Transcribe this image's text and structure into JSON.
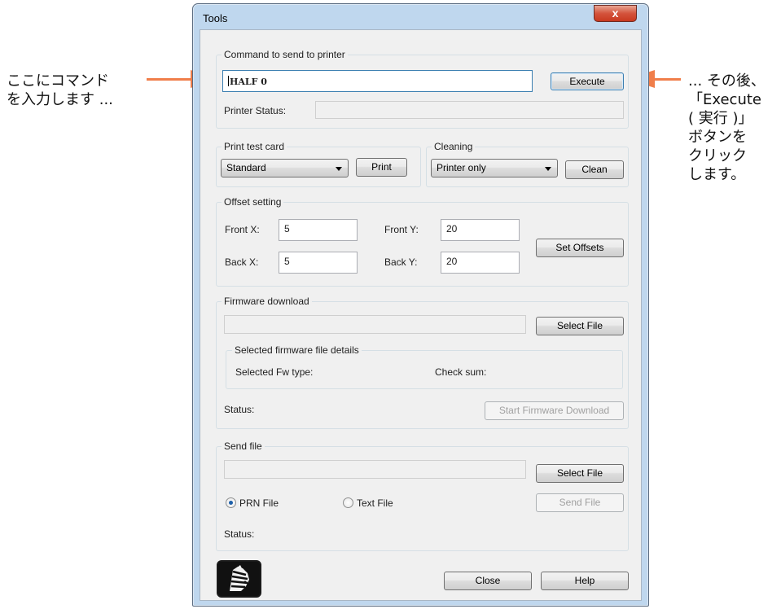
{
  "callouts": {
    "left": [
      "ここにコマンド",
      "を入力します ..."
    ],
    "right": [
      "... その後、",
      "「Execute",
      "( 実行 )」",
      "ボタンを",
      "クリック",
      "します。"
    ]
  },
  "colors": {
    "arrow": "#f07e4a",
    "title_close": "#c8391f"
  },
  "window": {
    "title": "Tools",
    "close_glyph": "x"
  },
  "command": {
    "group_label": "Command to send to printer",
    "value": "HALF 0",
    "execute_label": "Execute",
    "status_label": "Printer Status:",
    "status_value": ""
  },
  "print_test": {
    "group_label": "Print test card",
    "selected": "Standard",
    "print_label": "Print"
  },
  "cleaning": {
    "group_label": "Cleaning",
    "selected": "Printer only",
    "clean_label": "Clean"
  },
  "offset": {
    "group_label": "Offset setting",
    "front_x_label": "Front X:",
    "front_x": "5",
    "front_y_label": "Front Y:",
    "front_y": "20",
    "back_x_label": "Back X:",
    "back_x": "5",
    "back_y_label": "Back Y:",
    "back_y": "20",
    "set_label": "Set Offsets"
  },
  "firmware": {
    "group_label": "Firmware download",
    "file_value": "",
    "select_label": "Select File",
    "details_label": "Selected firmware file details",
    "fw_type_label": "Selected Fw type:",
    "checksum_label": "Check sum:",
    "status_label": "Status:",
    "start_label": "Start Firmware Download"
  },
  "send_file": {
    "group_label": "Send file",
    "file_value": "",
    "select_label": "Select File",
    "prn_label": "PRN File",
    "text_label": "Text File",
    "send_label": "Send File",
    "status_label": "Status:"
  },
  "footer": {
    "close_label": "Close",
    "help_label": "Help",
    "logo_icon": "zebra-logo-icon"
  }
}
